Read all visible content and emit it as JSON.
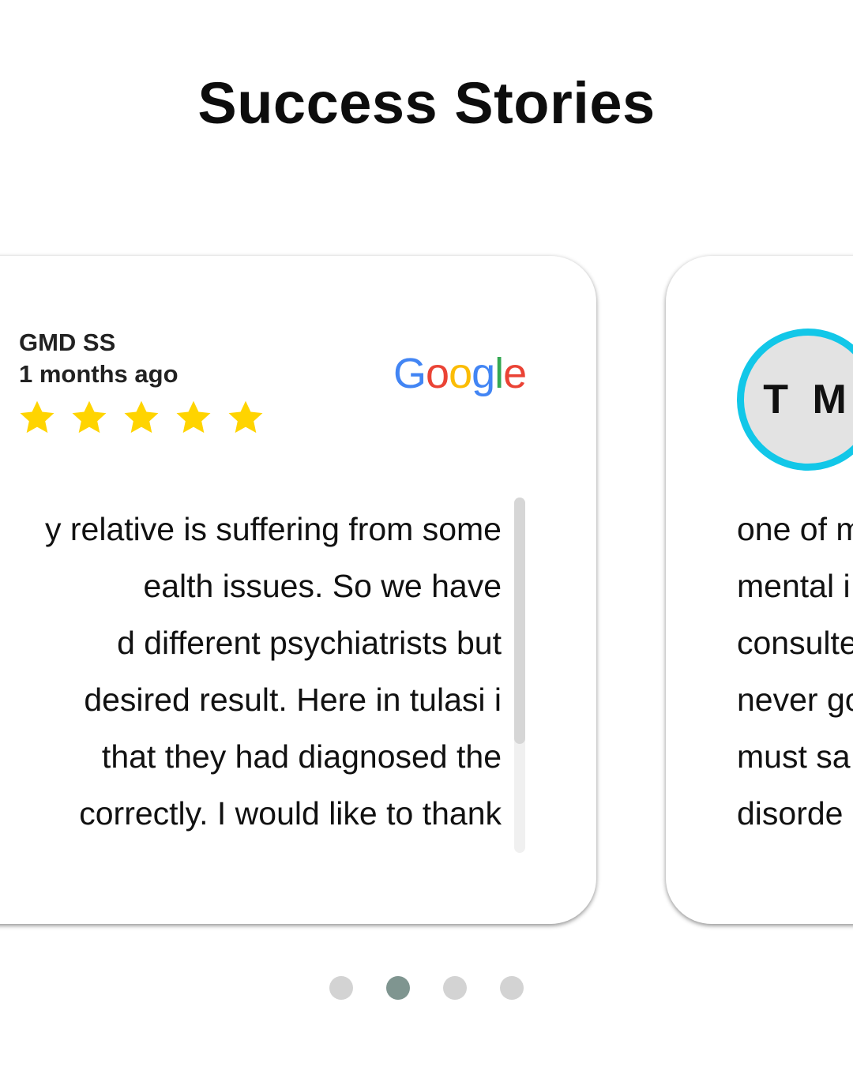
{
  "page": {
    "title": "Success Stories"
  },
  "reviews": [
    {
      "name": "GMD SS",
      "time": "1 months ago",
      "rating": 5,
      "source": "Google",
      "text_lines": [
        "y relative is suffering from some",
        "ealth issues. So we have",
        "d different psychiatrists but",
        " desired result. Here in tulasi i",
        "that they had diagnosed the",
        "correctly. I would like to thank"
      ]
    },
    {
      "avatar_initials": "T M",
      "text_lines": [
        "one of m",
        "mental i",
        "consulte",
        "never go",
        "must sa",
        "disorde"
      ]
    }
  ],
  "pagination": {
    "count": 4,
    "active_index": 1
  },
  "colors": {
    "star": "#FFD400",
    "avatar_ring": "#12c7e8",
    "dot_active": "#7f9590",
    "dot_inactive": "#d3d3d3"
  }
}
